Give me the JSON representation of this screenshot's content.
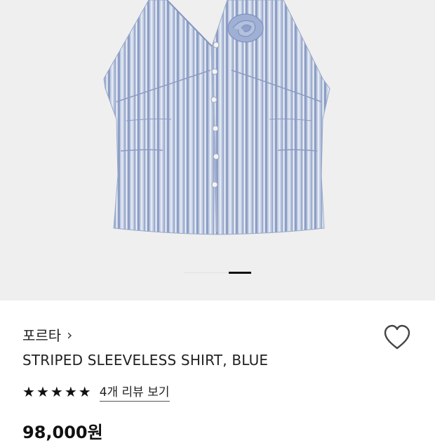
{
  "product": {
    "brand": "포르타",
    "brand_chevron": "›",
    "title": "STRIPED SLEEVELESS SHIRT, BLUE",
    "rating_stars": 5,
    "review_link": "4개 리뷰 보기",
    "price": "98,000원"
  },
  "gallery": {
    "image_alt": "blue striped sleeveless halter shirt with rosette",
    "active_page": 2,
    "page_count": 3
  },
  "colors": {
    "background": "#efefef",
    "shirt_base": "#b9c4db",
    "stripe_blue": "#8d9fc6",
    "stripe_light": "#dfe5f0"
  },
  "icons": {
    "wishlist": "heart-outline-icon",
    "star": "star-filled-icon",
    "chevron": "chevron-right-icon"
  }
}
